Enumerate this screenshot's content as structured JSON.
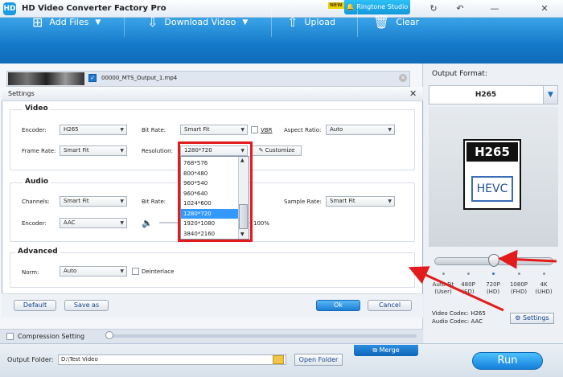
{
  "app": {
    "title": "HD Video Converter Factory Pro",
    "logo_text": "HD",
    "new_tag": "NEW",
    "ringtone_label": "Ringtone Studio"
  },
  "window_controls": {
    "refresh": "↻",
    "back": "↶",
    "minimize": "—",
    "close": "✕"
  },
  "toolbar": {
    "add_files": "Add Files",
    "download_video": "Download Video",
    "upload": "Upload",
    "clear": "Clear"
  },
  "file": {
    "name": "00000_MTS_Output_1.mp4",
    "checked": "✓",
    "close": "✕"
  },
  "settings_dialog": {
    "title": "Settings",
    "close": "✕",
    "video": {
      "title": "Video",
      "encoder_label": "Encoder:",
      "encoder_value": "H265",
      "bitrate_label": "Bit Rate:",
      "bitrate_value": "Smart Fit",
      "vbr_label": "VBR",
      "aspect_label": "Aspect Ratio:",
      "aspect_value": "Auto",
      "framerate_label": "Frame Rate:",
      "framerate_value": "Smart Fit",
      "resolution_label": "Resolution:",
      "resolution_value": "1280*720",
      "customize_label": "Customize"
    },
    "resolution_options": [
      "768*576",
      "800*480",
      "960*540",
      "960*640",
      "1024*600",
      "1280*720",
      "1920*1080",
      "3840*2160"
    ],
    "resolution_selected": "1280*720",
    "audio": {
      "title": "Audio",
      "channels_label": "Channels:",
      "channels_value": "Smart Fit",
      "bitrate_label": "Bit Rate:",
      "samplerate_label": "Sample Rate:",
      "samplerate_value": "Smart Fit",
      "encoder_label": "Encoder:",
      "encoder_value": "AAC",
      "volume_value": "100%"
    },
    "advanced": {
      "title": "Advanced",
      "norm_label": "Norm:",
      "norm_value": "Auto",
      "deinterlace_label": "Deinterlace"
    },
    "buttons": {
      "default": "Default",
      "save_as": "Save as",
      "ok": "Ok",
      "cancel": "Cancel"
    }
  },
  "compression": {
    "label": "Compression Setting"
  },
  "bottom": {
    "output_folder_label": "Output Folder:",
    "output_folder_value": "D:\\Test Video",
    "open_folder": "Open Folder",
    "merge": "Merge",
    "run": "Run"
  },
  "output_format": {
    "label": "Output Format:",
    "value": "H265",
    "card_top": "H265",
    "card_bottom": "HEVC",
    "quality_levels": [
      {
        "line1": "Auto Fit",
        "line2": "(User)"
      },
      {
        "line1": "480P",
        "line2": "(SD)"
      },
      {
        "line1": "720P",
        "line2": "(HD)"
      },
      {
        "line1": "1080P",
        "line2": "(FHD)"
      },
      {
        "line1": "4K",
        "line2": "(UHD)"
      }
    ],
    "quality_selected": "720P",
    "video_codec": "Video Codec: H265",
    "audio_codec": "Audio Codec: AAC",
    "settings_button": "Settings"
  },
  "colors": {
    "accent": "#1478c8",
    "highlight": "#e21c1c",
    "selection": "#3399ff"
  }
}
